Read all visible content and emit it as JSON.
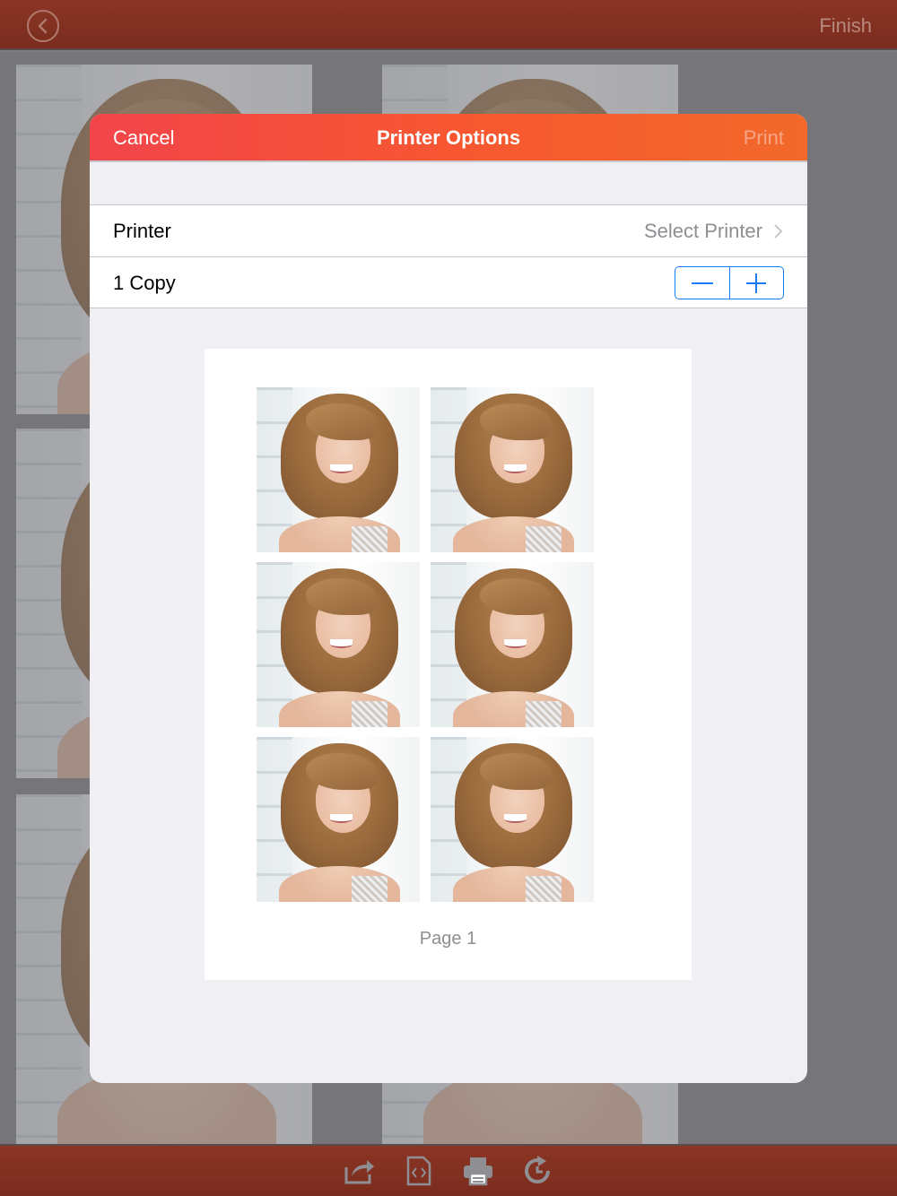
{
  "topbar": {
    "finish_label": "Finish"
  },
  "modal": {
    "cancel_label": "Cancel",
    "title": "Printer Options",
    "print_label": "Print",
    "printer_row": {
      "label": "Printer",
      "value": "Select Printer"
    },
    "copies_row": {
      "label": "1 Copy"
    },
    "page_label": "Page 1",
    "photo_count": 6
  },
  "toolbar": {
    "icons": [
      "share-icon",
      "code-icon",
      "printer-icon",
      "refresh-icon"
    ]
  },
  "colors": {
    "bar": "#8b3524",
    "header_gradient_start": "#f2454b",
    "header_gradient_end": "#f2692a",
    "stepper_accent": "#1a7cf5",
    "print_disabled": "#f7a487"
  }
}
